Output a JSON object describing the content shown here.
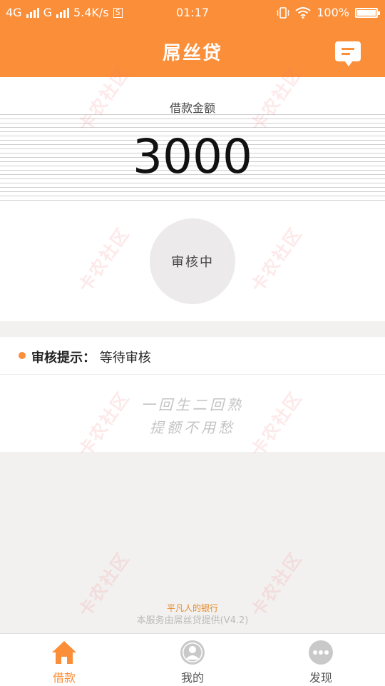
{
  "status_bar": {
    "network1": "4G",
    "network2": "G",
    "speed": "5.4K/s",
    "s_badge": "S",
    "time": "01:17",
    "battery": "100%"
  },
  "header": {
    "title": "屌丝贷",
    "message_icon": "chat-bubble-icon"
  },
  "loan": {
    "label": "借款金额",
    "amount": "3000",
    "status": "审核中"
  },
  "review": {
    "label": "审核提示：",
    "value": "等待审核"
  },
  "slogan": {
    "line1": "一回生二回熟",
    "line2": "提额不用愁"
  },
  "footer": {
    "tagline": "平凡人的银行",
    "credit": "本服务由屌丝贷提供(V4.2)"
  },
  "tabs": [
    {
      "label": "借款",
      "icon": "home-icon",
      "active": true
    },
    {
      "label": "我的",
      "icon": "user-avatar-icon",
      "active": false
    },
    {
      "label": "发现",
      "icon": "more-dots-icon",
      "active": false
    }
  ],
  "watermark": "卡农社区",
  "colors": {
    "brand": "#fb8e38",
    "background": "#f2f1f0"
  }
}
